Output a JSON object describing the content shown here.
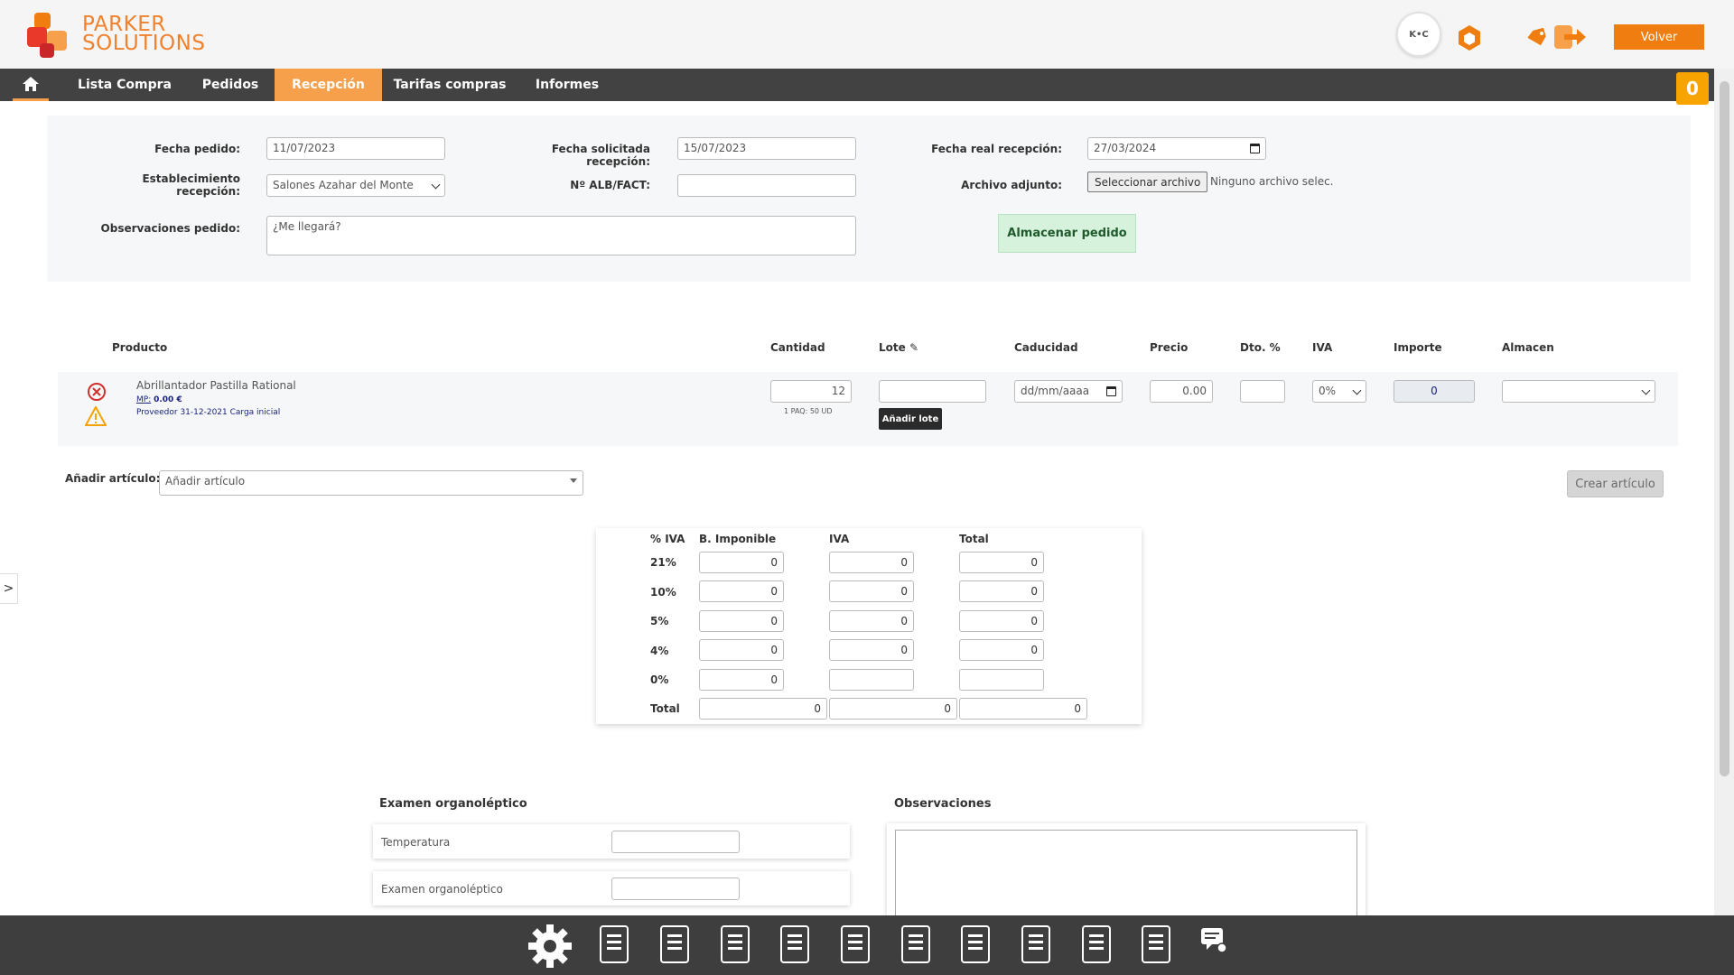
{
  "header": {
    "logo_line1": "PARKER",
    "logo_line2": "SOLUTIONS",
    "avatar_initials": "K•C",
    "back_button": "Volver",
    "brand_color": "#f07d10"
  },
  "nav": {
    "home_icon": "home-icon",
    "items": [
      {
        "label": "Lista Compra"
      },
      {
        "label": "Pedidos"
      },
      {
        "label": "Recepción"
      },
      {
        "label": "Tarifas compras"
      },
      {
        "label": "Informes"
      }
    ],
    "active_index": 2,
    "cart_count": "0"
  },
  "form": {
    "fecha_pedido_label": "Fecha pedido:",
    "fecha_pedido_value": "11/07/2023",
    "fecha_solicitada_label": "Fecha solicitada recepción:",
    "fecha_solicitada_value": "15/07/2023",
    "fecha_real_label": "Fecha real recepción:",
    "fecha_real_value": "27/03/2024",
    "establecimiento_label": "Establecimiento recepción:",
    "establecimiento_value": "Salones Azahar del Monte",
    "alb_label": "Nº ALB/FACT:",
    "alb_value": "",
    "archivo_label": "Archivo adjunto:",
    "archivo_button": "Seleccionar archivo",
    "archivo_none": "Ninguno archivo selec.",
    "observaciones_label": "Observaciones pedido:",
    "observaciones_value": "¿Me llegará?",
    "store_button": "Almacenar pedido"
  },
  "products": {
    "columns": [
      "Producto",
      "Cantidad",
      "Lote",
      "Caducidad",
      "Precio",
      "Dto. %",
      "IVA",
      "Importe",
      "Almacen"
    ],
    "rows": [
      {
        "name": "Abrillantador Pastilla Rational",
        "mp_label": "MP:",
        "mp_value": "0.00 €",
        "proveedor": "Proveedor 31-12-2021 Carga inicial",
        "cantidad": "12",
        "pack_note": "1 PAQ: 50 UD",
        "lote": "",
        "add_lote_button": "Añadir lote",
        "caducidad_placeholder": "dd/mm/aaaa",
        "precio": "0.00",
        "dto": "",
        "iva": "0%",
        "importe": "0",
        "almacen": ""
      }
    ]
  },
  "add_article": {
    "label": "Añadir artículo:",
    "placeholder": "Añadir artículo",
    "create_button": "Crear artículo"
  },
  "tax_summary": {
    "headers": [
      "% IVA",
      "B. Imponible",
      "IVA",
      "Total"
    ],
    "rows": [
      {
        "rate": "21%",
        "base": "0",
        "iva": "0",
        "total": "0"
      },
      {
        "rate": "10%",
        "base": "0",
        "iva": "0",
        "total": "0"
      },
      {
        "rate": "5%",
        "base": "0",
        "iva": "0",
        "total": "0"
      },
      {
        "rate": "4%",
        "base": "0",
        "iva": "0",
        "total": "0"
      },
      {
        "rate": "0%",
        "base": "0",
        "iva": "",
        "total": ""
      }
    ],
    "total_label": "Total",
    "total_base": "0",
    "total_iva": "0",
    "total_total": "0"
  },
  "organoleptic": {
    "title": "Examen organoléptico",
    "fields": [
      {
        "label": "Temperatura",
        "value": ""
      },
      {
        "label": "Examen organoléptico",
        "value": ""
      }
    ]
  },
  "observaciones": {
    "title": "Observaciones",
    "value": ""
  },
  "toolbar": {
    "icons": [
      "gear-icon",
      "headset-icon",
      "handshake-icon",
      "cutlery-icon",
      "pen-icon",
      "marker-icon",
      "cart-icon",
      "contacts-icon",
      "mobile-icon",
      "euro-icon",
      "chart-icon",
      "chat-icon"
    ]
  }
}
